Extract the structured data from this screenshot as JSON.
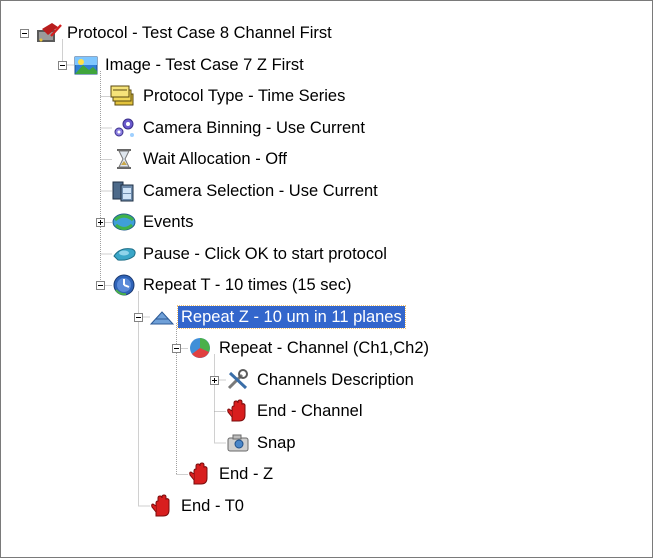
{
  "tree": {
    "items": [
      {
        "label": "Protocol - Test Case 8 Channel First",
        "icon": "protocol-icon",
        "depth": 0,
        "expander": "minus"
      },
      {
        "label": "Image - Test Case 7 Z First",
        "icon": "image-icon",
        "depth": 1,
        "expander": "minus"
      },
      {
        "label": "Protocol Type - Time Series",
        "icon": "protocol-type-icon",
        "depth": 2,
        "expander": null
      },
      {
        "label": "Camera Binning - Use Current",
        "icon": "camera-binning-icon",
        "depth": 2,
        "expander": null
      },
      {
        "label": "Wait Allocation - Off",
        "icon": "hourglass-icon",
        "depth": 2,
        "expander": null
      },
      {
        "label": "Camera Selection - Use Current",
        "icon": "camera-selection-icon",
        "depth": 2,
        "expander": null
      },
      {
        "label": "Events",
        "icon": "events-icon",
        "depth": 2,
        "expander": "plus"
      },
      {
        "label": "Pause - Click OK to start protocol",
        "icon": "pause-icon",
        "depth": 2,
        "expander": null
      },
      {
        "label": "Repeat T - 10 times (15 sec)",
        "icon": "clock-icon",
        "depth": 2,
        "expander": "minus"
      },
      {
        "label": "Repeat Z - 10 um in 11 planes",
        "icon": "z-stack-icon",
        "depth": 3,
        "expander": "minus",
        "selected": true
      },
      {
        "label": "Repeat - Channel (Ch1,Ch2)",
        "icon": "channel-icon",
        "depth": 4,
        "expander": "minus"
      },
      {
        "label": "Channels Description",
        "icon": "tools-icon",
        "depth": 5,
        "expander": "plus"
      },
      {
        "label": "End - Channel",
        "icon": "stop-hand-icon",
        "depth": 5,
        "expander": null
      },
      {
        "label": "Snap",
        "icon": "camera-snap-icon",
        "depth": 5,
        "expander": null
      },
      {
        "label": "End - Z",
        "icon": "stop-hand-icon",
        "depth": 4,
        "expander": null
      },
      {
        "label": "End - T0",
        "icon": "stop-hand-icon",
        "depth": 3,
        "expander": null
      }
    ]
  }
}
